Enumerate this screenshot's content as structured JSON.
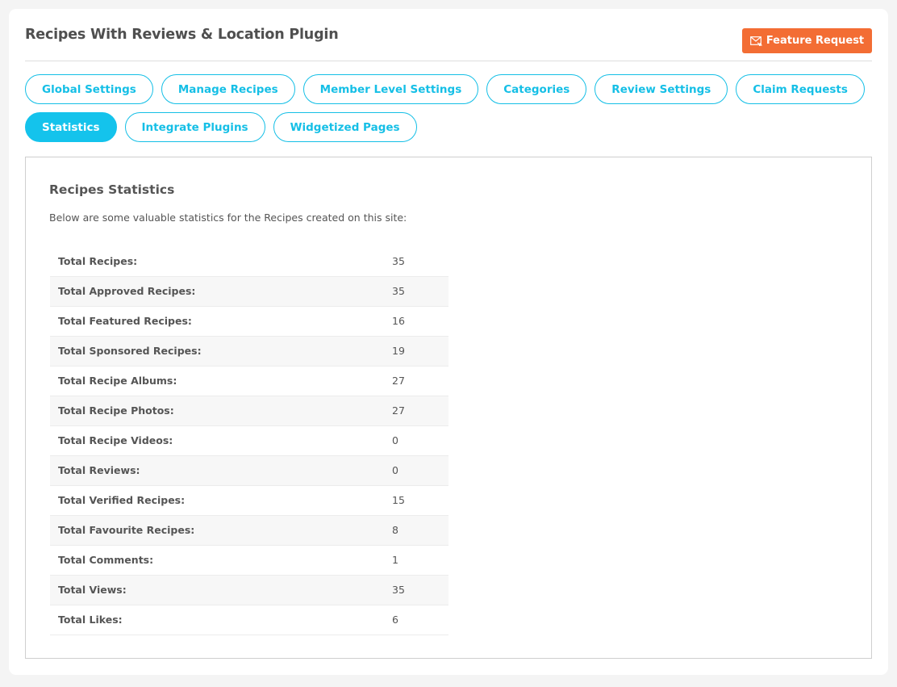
{
  "header": {
    "title": "Recipes With Reviews & Location Plugin",
    "feature_request_label": "Feature Request",
    "feature_request_icon": "mail-icon",
    "accent_color": "#f36d34"
  },
  "tabs": {
    "row1": [
      {
        "label": "Global Settings",
        "active": false
      },
      {
        "label": "Manage Recipes",
        "active": false
      },
      {
        "label": "Member Level Settings",
        "active": false
      },
      {
        "label": "Categories",
        "active": false
      },
      {
        "label": "Review Settings",
        "active": false
      },
      {
        "label": "Claim Requests",
        "active": false
      }
    ],
    "row2": [
      {
        "label": "Statistics",
        "active": true
      },
      {
        "label": "Integrate Plugins",
        "active": false
      },
      {
        "label": "Widgetized Pages",
        "active": false
      }
    ],
    "tab_color": "#15bfe6"
  },
  "panel": {
    "title": "Recipes Statistics",
    "description": "Below are some valuable statistics for the Recipes created on this site:",
    "stats": [
      {
        "label": "Total Recipes:",
        "value": "35"
      },
      {
        "label": "Total Approved Recipes:",
        "value": "35"
      },
      {
        "label": "Total Featured Recipes:",
        "value": "16"
      },
      {
        "label": "Total Sponsored Recipes:",
        "value": "19"
      },
      {
        "label": "Total Recipe Albums:",
        "value": "27"
      },
      {
        "label": "Total Recipe Photos:",
        "value": "27"
      },
      {
        "label": "Total Recipe Videos:",
        "value": "0"
      },
      {
        "label": "Total Reviews:",
        "value": "0"
      },
      {
        "label": "Total Verified Recipes:",
        "value": "15"
      },
      {
        "label": "Total Favourite Recipes:",
        "value": "8"
      },
      {
        "label": "Total Comments:",
        "value": "1"
      },
      {
        "label": "Total Views:",
        "value": "35"
      },
      {
        "label": "Total Likes:",
        "value": "6"
      }
    ]
  }
}
